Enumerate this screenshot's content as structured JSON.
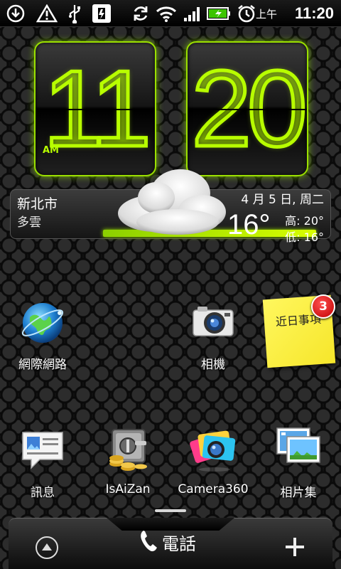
{
  "status_bar": {
    "ampm": "上午",
    "time": "11:20",
    "icons": [
      "download-icon",
      "warning-icon",
      "usb-icon",
      "debug-icon",
      "sync-icon",
      "wifi-icon",
      "signal-icon",
      "battery-charging-icon",
      "alarm-icon"
    ]
  },
  "clock": {
    "hour": "11",
    "minute": "20",
    "ampm": "AM"
  },
  "weather": {
    "city": "新北市",
    "condition": "多雲",
    "date": "4 月 5 日, 周二",
    "temp_now": "16°",
    "high": "高: 20°",
    "low": "低: 16°",
    "icon": "cloud-icon"
  },
  "apps_row1": [
    {
      "label": "網際網路",
      "icon": "globe-icon"
    },
    {
      "label": "相機",
      "icon": "camera-icon"
    }
  ],
  "note": {
    "text": "近日事項",
    "badge": "3"
  },
  "apps_row2": [
    {
      "label": "訊息",
      "icon": "message-icon"
    },
    {
      "label": "IsAiZan",
      "icon": "safe-coins-icon"
    },
    {
      "label": "Camera360",
      "icon": "camera360-icon"
    },
    {
      "label": "相片集",
      "icon": "gallery-icon"
    }
  ],
  "dock": {
    "phone_label": "電話",
    "left_icon": "arrow-up-icon",
    "right_icon": "plus-icon"
  },
  "colors": {
    "accent": "#b8ff00",
    "badge": "#d40000",
    "note": "#fff34a"
  }
}
